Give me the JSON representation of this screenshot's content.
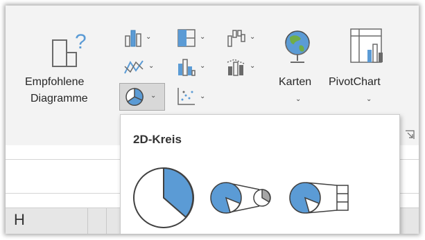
{
  "ribbon": {
    "recommended_label_line1": "Empfohlene",
    "recommended_label_line2": "Diagramme",
    "maps_label": "Karten",
    "pivotchart_label": "PivotChart"
  },
  "dropdown": {
    "section_title": "2D-Kreis",
    "items": [
      "pie",
      "pie-of-pie",
      "bar-of-pie"
    ]
  },
  "sheet": {
    "column_header": "H"
  },
  "colors": {
    "accent_blue": "#5b9bd5",
    "icon_green": "#70ad47",
    "ribbon_bg": "#f3f3f3"
  }
}
